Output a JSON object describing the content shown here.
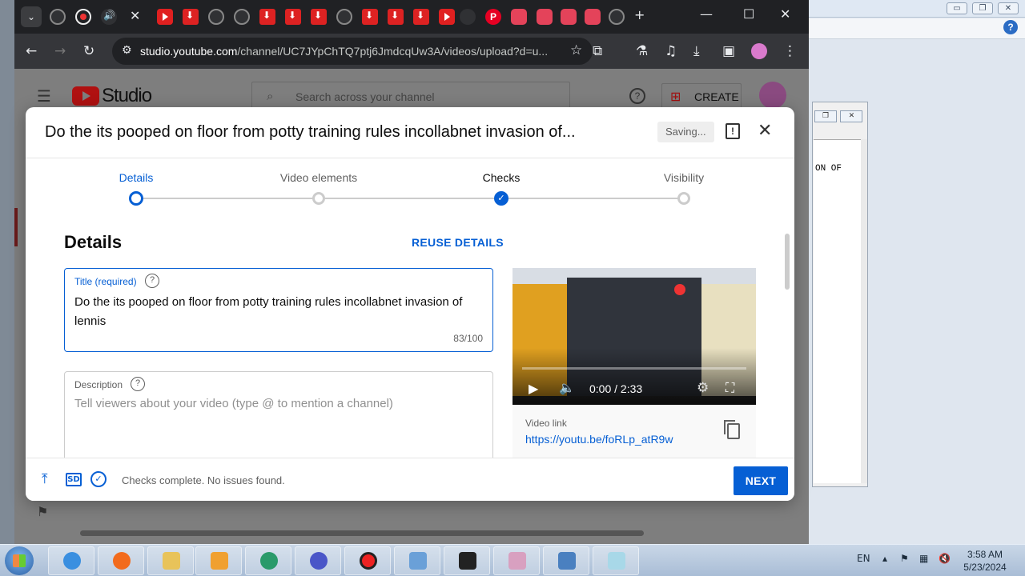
{
  "browser": {
    "url_host": "studio.youtube.com",
    "url_path": "/channel/UC7JYpChTQ7ptj6JmdcqUw3A/videos/upload?d=u..."
  },
  "studio": {
    "logo_text": "Studio",
    "search_placeholder": "Search across your channel",
    "create_label": "CREATE"
  },
  "dialog": {
    "title": "Do the its pooped on floor from potty training rules incollabnet invasion of...",
    "saving": "Saving...",
    "steps": [
      {
        "label": "Details",
        "state": "active"
      },
      {
        "label": "Video elements",
        "state": "pending"
      },
      {
        "label": "Checks",
        "state": "done"
      },
      {
        "label": "Visibility",
        "state": "pending"
      }
    ],
    "section_title": "Details",
    "reuse_label": "REUSE DETAILS",
    "title_field": {
      "label": "Title (required)",
      "value": "Do the its pooped on floor from potty training rules incollabnet invasion of lennis",
      "count": "83/100"
    },
    "description_field": {
      "label": "Description",
      "placeholder": "Tell viewers about your video (type @ to mention a channel)"
    },
    "preview": {
      "time": "0:00 / 2:33",
      "link_label": "Video link",
      "link": "https://youtu.be/foRLp_atR9w"
    },
    "footer": {
      "sd_label": "SD",
      "status": "Checks complete. No issues found.",
      "next_label": "NEXT"
    }
  },
  "bg_window": {
    "text": "ON OF"
  },
  "taskbar": {
    "lang": "EN",
    "time": "3:58 AM",
    "date": "5/23/2024"
  },
  "colors": {
    "accent": "#065fd4",
    "chrome_dark": "#202124",
    "youtube_red": "#ff0000"
  }
}
